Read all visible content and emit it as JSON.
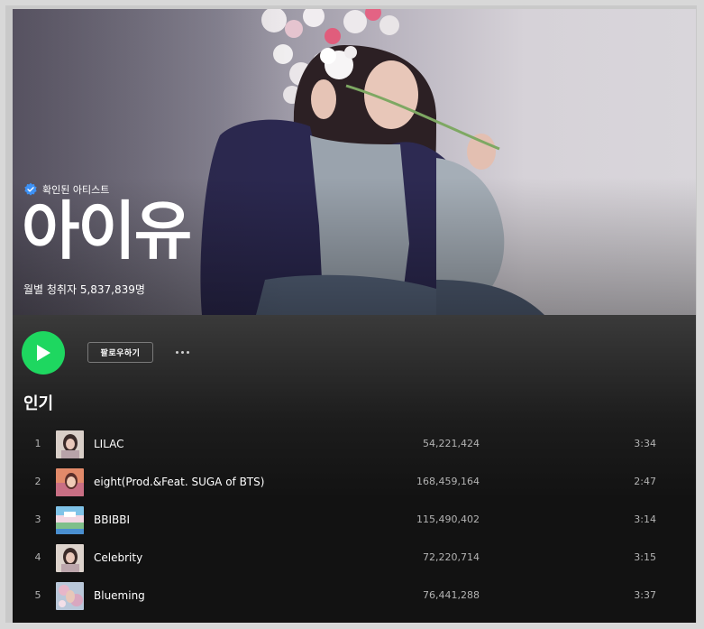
{
  "artist": {
    "verified_label": "확인된 아티스트",
    "name": "아이유",
    "monthly_listeners": "월별 청취자 5,837,839명"
  },
  "controls": {
    "play": "play-icon",
    "follow_label": "팔로우하기",
    "more": "more-icon"
  },
  "section": {
    "title": "인기"
  },
  "tracks": [
    {
      "num": "1",
      "title": "LILAC",
      "plays": "54,221,424",
      "duration": "3:34"
    },
    {
      "num": "2",
      "title": "eight(Prod.&Feat. SUGA of BTS)",
      "plays": "168,459,164",
      "duration": "2:47"
    },
    {
      "num": "3",
      "title": "BBIBBI",
      "plays": "115,490,402",
      "duration": "3:14"
    },
    {
      "num": "4",
      "title": "Celebrity",
      "plays": "72,220,714",
      "duration": "3:15"
    },
    {
      "num": "5",
      "title": "Blueming",
      "plays": "76,441,288",
      "duration": "3:37"
    }
  ],
  "colors": {
    "accent": "#1ed760",
    "background": "#121212",
    "verified": "#3d91f4"
  }
}
